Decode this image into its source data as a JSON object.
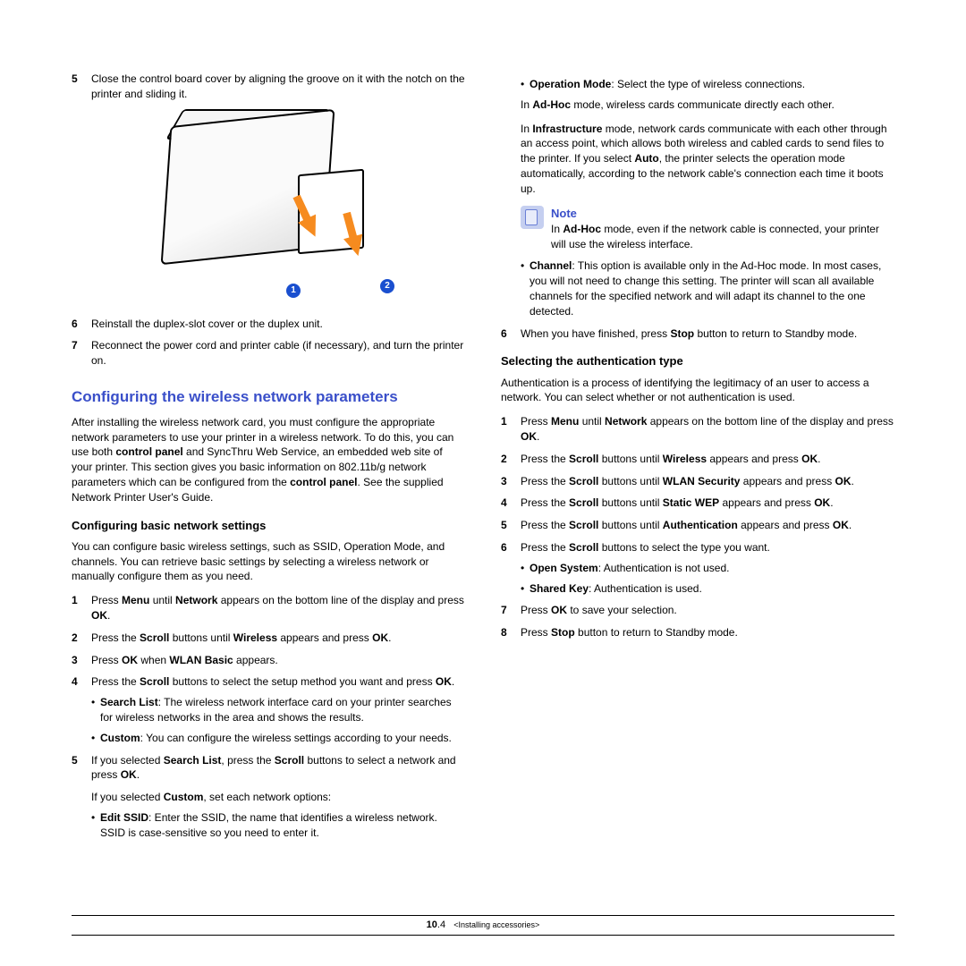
{
  "left": {
    "step5": {
      "num": "5",
      "text_a": "Close the control board cover by aligning the groove on it with the notch on the printer and sliding it."
    },
    "callout1": "1",
    "callout2": "2",
    "step6": {
      "num": "6",
      "text": "Reinstall the duplex-slot cover or the duplex unit."
    },
    "step7": {
      "num": "7",
      "text": "Reconnect the power cord and printer cable (if necessary), and turn the printer on."
    },
    "h_blue": "Configuring the wireless network parameters",
    "intro_a": "After installing the wireless network card, you must configure the appropriate network parameters to use your printer in a wireless network. To do this, you can use both ",
    "intro_b": "control panel",
    "intro_c": " and SyncThru Web Service, an embedded web site of your printer. This section gives you basic information on 802.11b/g network parameters which can be configured from the ",
    "intro_d": "control panel",
    "intro_e": ". See the supplied Network Printer User's Guide.",
    "h_basic": "Configuring basic network settings",
    "basic_intro": "You can configure basic wireless settings, such as SSID, Operation Mode, and channels. You can retrieve basic settings by selecting a wireless network or manually configure them as you need.",
    "b1": {
      "num": "1",
      "a": "Press ",
      "b": "Menu",
      "c": " until ",
      "d": "Network",
      "e": " appears on the bottom line of the display and press ",
      "f": "OK",
      "g": "."
    },
    "b2": {
      "num": "2",
      "a": "Press the ",
      "b": "Scroll",
      "c": " buttons until ",
      "d": "Wireless",
      "e": " appears and press ",
      "f": "OK",
      "g": "."
    },
    "b3": {
      "num": "3",
      "a": "Press ",
      "b": "OK",
      "c": " when ",
      "d": "WLAN Basic",
      "e": " appears."
    },
    "b4": {
      "num": "4",
      "a": "Press the ",
      "b": "Scroll",
      "c": " buttons to select the setup method you want and press ",
      "d": "OK",
      "e": "."
    },
    "b4s1": {
      "a": "Search List",
      "b": ": The wireless network interface card on your printer searches for wireless networks in the area and shows the results."
    },
    "b4s2": {
      "a": "Custom",
      "b": ": You can configure the wireless settings according to your needs."
    },
    "b5": {
      "num": "5",
      "a": "If you selected ",
      "b": "Search List",
      "c": ", press the ",
      "d": "Scroll",
      "e": " buttons to select a network and press ",
      "f": "OK",
      "g": "."
    },
    "b5_alt": {
      "a": "If you selected ",
      "b": "Custom",
      "c": ", set each network options:"
    },
    "b5s1": {
      "a": "Edit SSID",
      "b": ": Enter the SSID, the name that identifies a wireless network. SSID is case-sensitive so you need to enter it."
    }
  },
  "right": {
    "opmode": {
      "a": "Operation Mode",
      "b": ": Select the type of wireless connections."
    },
    "adhoc": {
      "a": "In ",
      "b": "Ad-Hoc",
      "c": " mode, wireless cards communicate directly each other."
    },
    "infra": {
      "a": "In ",
      "b": "Infrastructure",
      "c": " mode, network cards communicate with each other through an access point, which allows both wireless and cabled cards to send files to the printer. If you select ",
      "d": "Auto",
      "e": ", the printer selects the operation mode automatically, according to the network cable's connection each time it boots up."
    },
    "note_label": "Note",
    "note_text": {
      "a": "In ",
      "b": "Ad-Hoc",
      "c": " mode, even if the network cable is connected, your printer will use the wireless interface."
    },
    "channel": {
      "a": "Channel",
      "b": ": This option is available only in the Ad-Hoc mode. In most cases, you will not need to change this setting. The printer will scan all available channels for the specified network and will adapt its channel to the one detected."
    },
    "r6": {
      "num": "6",
      "a": "When you have finished, press ",
      "b": "Stop",
      "c": " button to return to Standby mode."
    },
    "h_auth": "Selecting the authentication type",
    "auth_intro": "Authentication is a process of identifying the legitimacy of an user to access a network. You can select whether or not authentication is used.",
    "a1": {
      "num": "1",
      "a": "Press ",
      "b": "Menu",
      "c": " until ",
      "d": "Network",
      "e": " appears on the bottom line of the display and press ",
      "f": "OK",
      "g": "."
    },
    "a2": {
      "num": "2",
      "a": "Press the ",
      "b": "Scroll",
      "c": " buttons until ",
      "d": "Wireless",
      "e": " appears and press ",
      "f": "OK",
      "g": "."
    },
    "a3": {
      "num": "3",
      "a": "Press the ",
      "b": "Scroll",
      "c": " buttons until ",
      "d": "WLAN Security",
      "e": " appears and press ",
      "f": "OK",
      "g": "."
    },
    "a4": {
      "num": "4",
      "a": "Press the ",
      "b": "Scroll",
      "c": " buttons until ",
      "d": "Static WEP",
      "e": " appears and press ",
      "f": "OK",
      "g": "."
    },
    "a5": {
      "num": "5",
      "a": "Press the ",
      "b": "Scroll",
      "c": " buttons until ",
      "d": "Authentication",
      "e": " appears and press ",
      "f": "OK",
      "g": "."
    },
    "a6": {
      "num": "6",
      "a": "Press the ",
      "b": "Scroll",
      "c": " buttons to select the type you want."
    },
    "a6s1": {
      "a": "Open System",
      "b": ": Authentication is not used."
    },
    "a6s2": {
      "a": "Shared Key",
      "b": ": Authentication is used."
    },
    "a7": {
      "num": "7",
      "a": "Press ",
      "b": "OK",
      "c": " to save your selection."
    },
    "a8": {
      "num": "8",
      "a": "Press ",
      "b": "Stop",
      "c": " button to return to Standby mode."
    }
  },
  "footer": {
    "page": "10",
    "sub": ".4",
    "chapter": "<Installing accessories>"
  }
}
